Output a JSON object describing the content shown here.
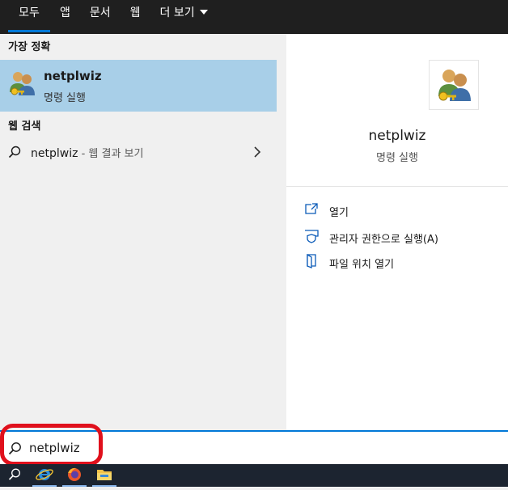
{
  "tabs": [
    {
      "label": "모두"
    },
    {
      "label": "앱"
    },
    {
      "label": "문서"
    },
    {
      "label": "웹"
    },
    {
      "label": "더 보기"
    }
  ],
  "best_match": {
    "header": "가장 정확",
    "title": "netplwiz",
    "subtitle": "명령 실행",
    "icon": "users-key-icon"
  },
  "web_search": {
    "header": "웹 검색",
    "query": "netplwiz",
    "suffix": " - 웹 결과 보기"
  },
  "detail": {
    "title": "netplwiz",
    "subtitle": "명령 실행",
    "actions": [
      {
        "label": "열기",
        "icon": "open-icon"
      },
      {
        "label": "관리자 권한으로 실행(A)",
        "icon": "shield-icon"
      },
      {
        "label": "파일 위치 열기",
        "icon": "file-location-icon"
      }
    ]
  },
  "search": {
    "value": "netplwiz"
  },
  "taskbar": {
    "items": [
      "search-icon",
      "internet-explorer-icon",
      "firefox-icon",
      "file-explorer-icon"
    ]
  },
  "colors": {
    "accent": "#0078d7",
    "selection": "#a8cfe8",
    "highlight_ring": "#e0101c",
    "tabbar": "#1f1f1f"
  }
}
